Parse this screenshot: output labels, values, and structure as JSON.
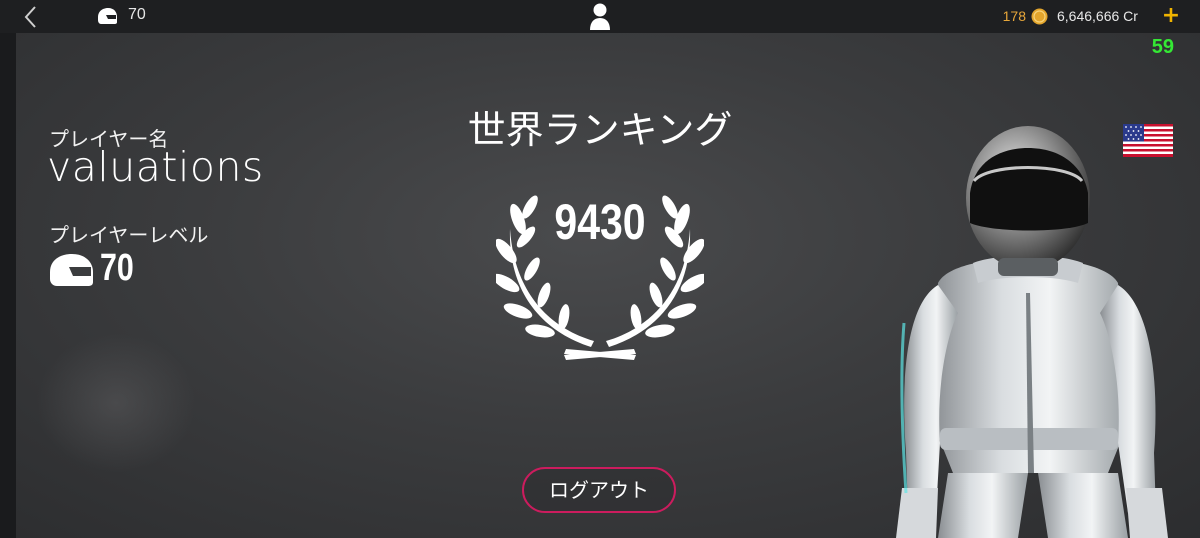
{
  "topbar": {
    "level": "70",
    "gold": "178",
    "credits": "6,646,666 Cr",
    "plus": "+"
  },
  "overlay": {
    "fps": "59"
  },
  "player": {
    "name_label": "プレイヤー名",
    "name": "valuations",
    "level_label": "プレイヤーレベル",
    "level": "70"
  },
  "ranking": {
    "title": "世界ランキング",
    "value": "9430"
  },
  "logout_label": "ログアウト",
  "icons": {
    "back": "back-chevron-icon",
    "helmet": "helmet-icon",
    "profile": "profile-icon",
    "coin": "gold-coin-icon",
    "flag": "us-flag-icon",
    "laurel": "laurel-wreath-icon"
  },
  "colors": {
    "gold": "#e8a73a",
    "plus": "#f0b400",
    "fps": "#34e834",
    "logout_border": "#cc1c5e"
  }
}
